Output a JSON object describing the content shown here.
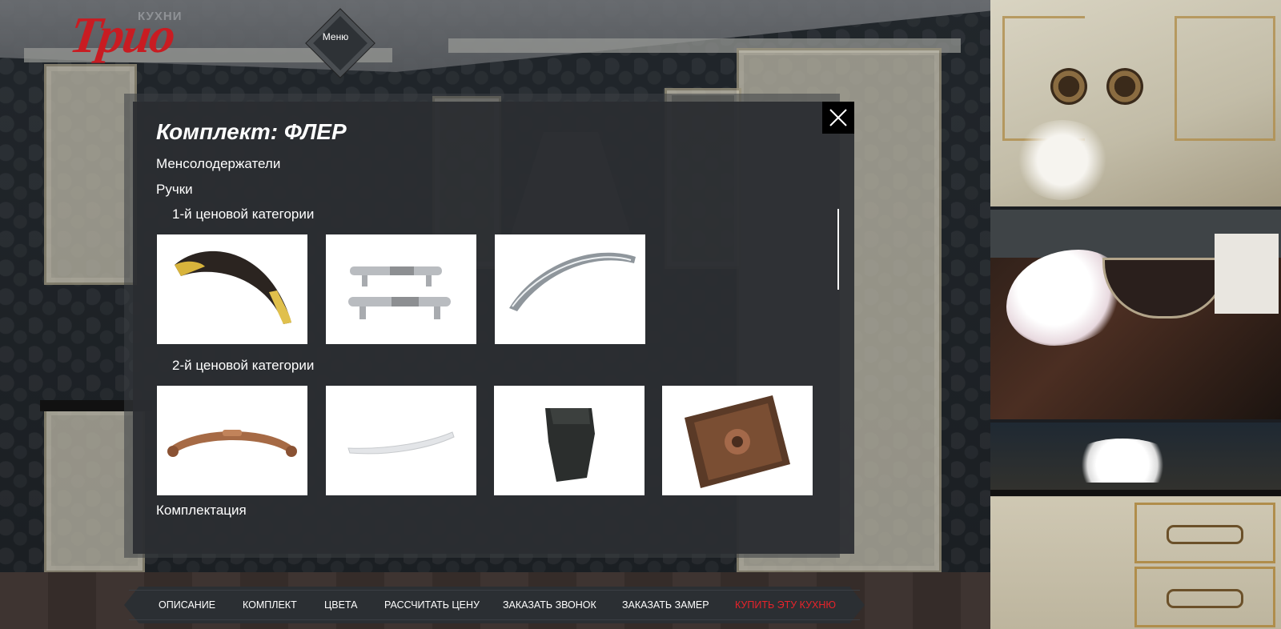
{
  "brand": {
    "logo_text": "Трио",
    "logo_sub": "КУХНИ",
    "accent_color": "#e8232a"
  },
  "menu": {
    "label": "Меню"
  },
  "modal": {
    "title": "Комплект: ФЛЕР",
    "sections": {
      "mensoles": "Менсолодержатели",
      "handles": "Ручки",
      "equipment": "Комплектация"
    },
    "categories": {
      "first": "1-й ценовой категории",
      "second": "2-й ценовой категории"
    },
    "handles_first": [
      {
        "icon": "arched-gold-handle"
      },
      {
        "icon": "double-rail-handle"
      },
      {
        "icon": "chrome-bow-handle"
      }
    ],
    "handles_second": [
      {
        "icon": "copper-pull-handle"
      },
      {
        "icon": "white-curved-handle"
      },
      {
        "icon": "black-knob-handle"
      },
      {
        "icon": "square-ornament-knob"
      }
    ]
  },
  "nav": {
    "items": [
      "ОПИСАНИЕ",
      "КОМПЛЕКТ",
      "ЦВЕТА",
      "РАССЧИТАТЬ ЦЕНУ",
      "ЗАКАЗАТЬ ЗВОНОК",
      "ЗАКАЗАТЬ ЗАМЕР"
    ],
    "cta": "КУПИТЬ ЭТУ КУХНЮ"
  }
}
